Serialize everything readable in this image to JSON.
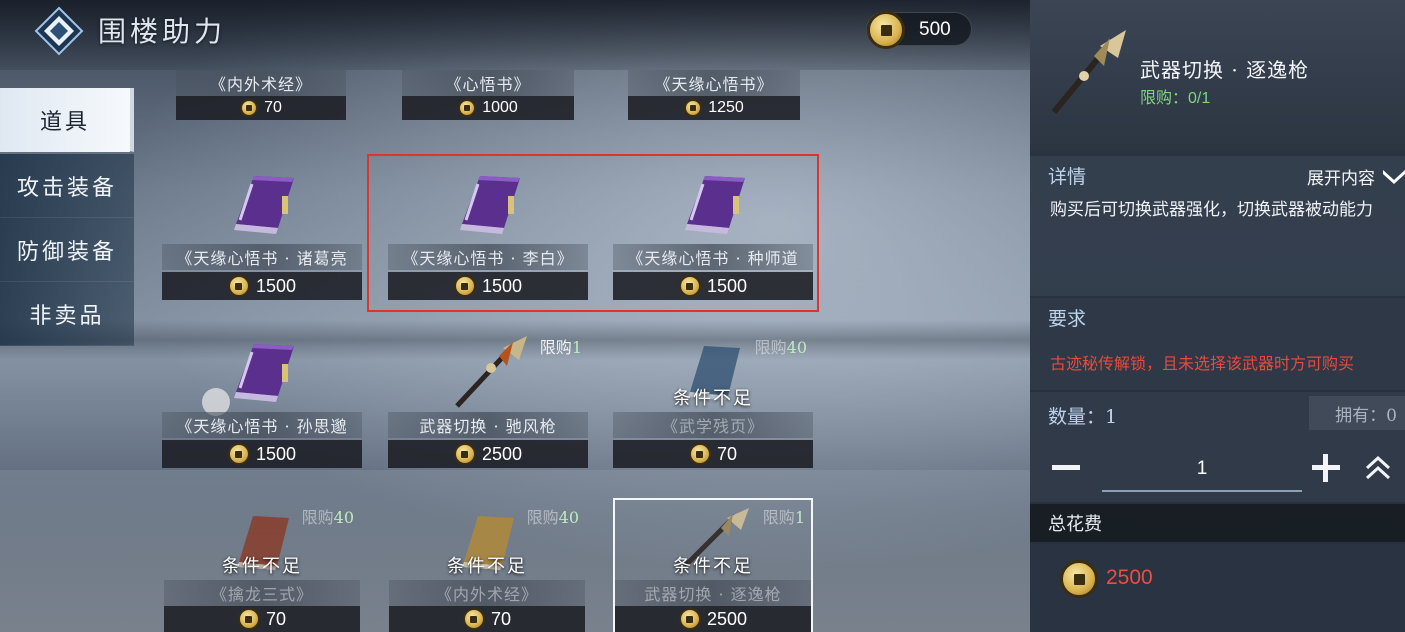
{
  "header": {
    "title": "围楼助力",
    "currency_amount": "500"
  },
  "sidebar": {
    "items": [
      {
        "label": "道具",
        "active": true
      },
      {
        "label": "攻击装备",
        "active": false
      },
      {
        "label": "防御装备",
        "active": false
      },
      {
        "label": "非卖品",
        "active": false
      }
    ]
  },
  "items": [
    {
      "name": "《内外术经》",
      "price": "70",
      "icon": "book-icon"
    },
    {
      "name": "《心悟书》",
      "price": "1000",
      "icon": "book-icon"
    },
    {
      "name": "《天缘心悟书》",
      "price": "1250",
      "icon": "book-icon"
    },
    {
      "name": "《天缘心悟书 · 诸葛亮",
      "price": "1500",
      "icon": "purple-book-icon"
    },
    {
      "name": "《天缘心悟书 · 李白》",
      "price": "1500",
      "icon": "purple-book-icon"
    },
    {
      "name": "《天缘心悟书 · 种师道",
      "price": "1500",
      "icon": "purple-book-icon"
    },
    {
      "name": "《天缘心悟书 · 孙思邈",
      "price": "1500",
      "icon": "purple-book-icon"
    },
    {
      "name": "武器切换 · 驰风枪",
      "price": "2500",
      "icon": "spear-icon",
      "limit_label": "限购",
      "limit_num": "1"
    },
    {
      "name": "《武学残页》",
      "price": "70",
      "icon": "blue-book-icon",
      "limit_label": "限购",
      "limit_num": "40",
      "condition": "条件不足"
    },
    {
      "name": "《擒龙三式》",
      "price": "70",
      "icon": "red-book-icon",
      "limit_label": "限购",
      "limit_num": "40",
      "condition": "条件不足"
    },
    {
      "name": "《内外术经》",
      "price": "70",
      "icon": "gold-book-icon",
      "limit_label": "限购",
      "limit_num": "40",
      "condition": "条件不足"
    },
    {
      "name": "武器切换 · 逐逸枪",
      "price": "2500",
      "icon": "spear-icon",
      "limit_label": "限购",
      "limit_num": "1",
      "condition": "条件不足"
    }
  ],
  "detail": {
    "item_name": "武器切换 · 逐逸枪",
    "limit": "限购：0/1",
    "details_label": "详情",
    "expand_label": "展开内容",
    "description": "购买后可切换武器强化，切换武器被动能力",
    "requirement_label": "要求",
    "requirement_text": "古迹秘传解锁，且未选择该武器时方可购买",
    "quantity_label": "数量：1",
    "owned": "拥有：0",
    "quantity_value": "1",
    "total_label": "总花费",
    "total_cost": "2500"
  },
  "colors": {
    "accent_red": "#e0332d",
    "limit_green": "#7fd67f",
    "cost_red": "#e8503f"
  }
}
